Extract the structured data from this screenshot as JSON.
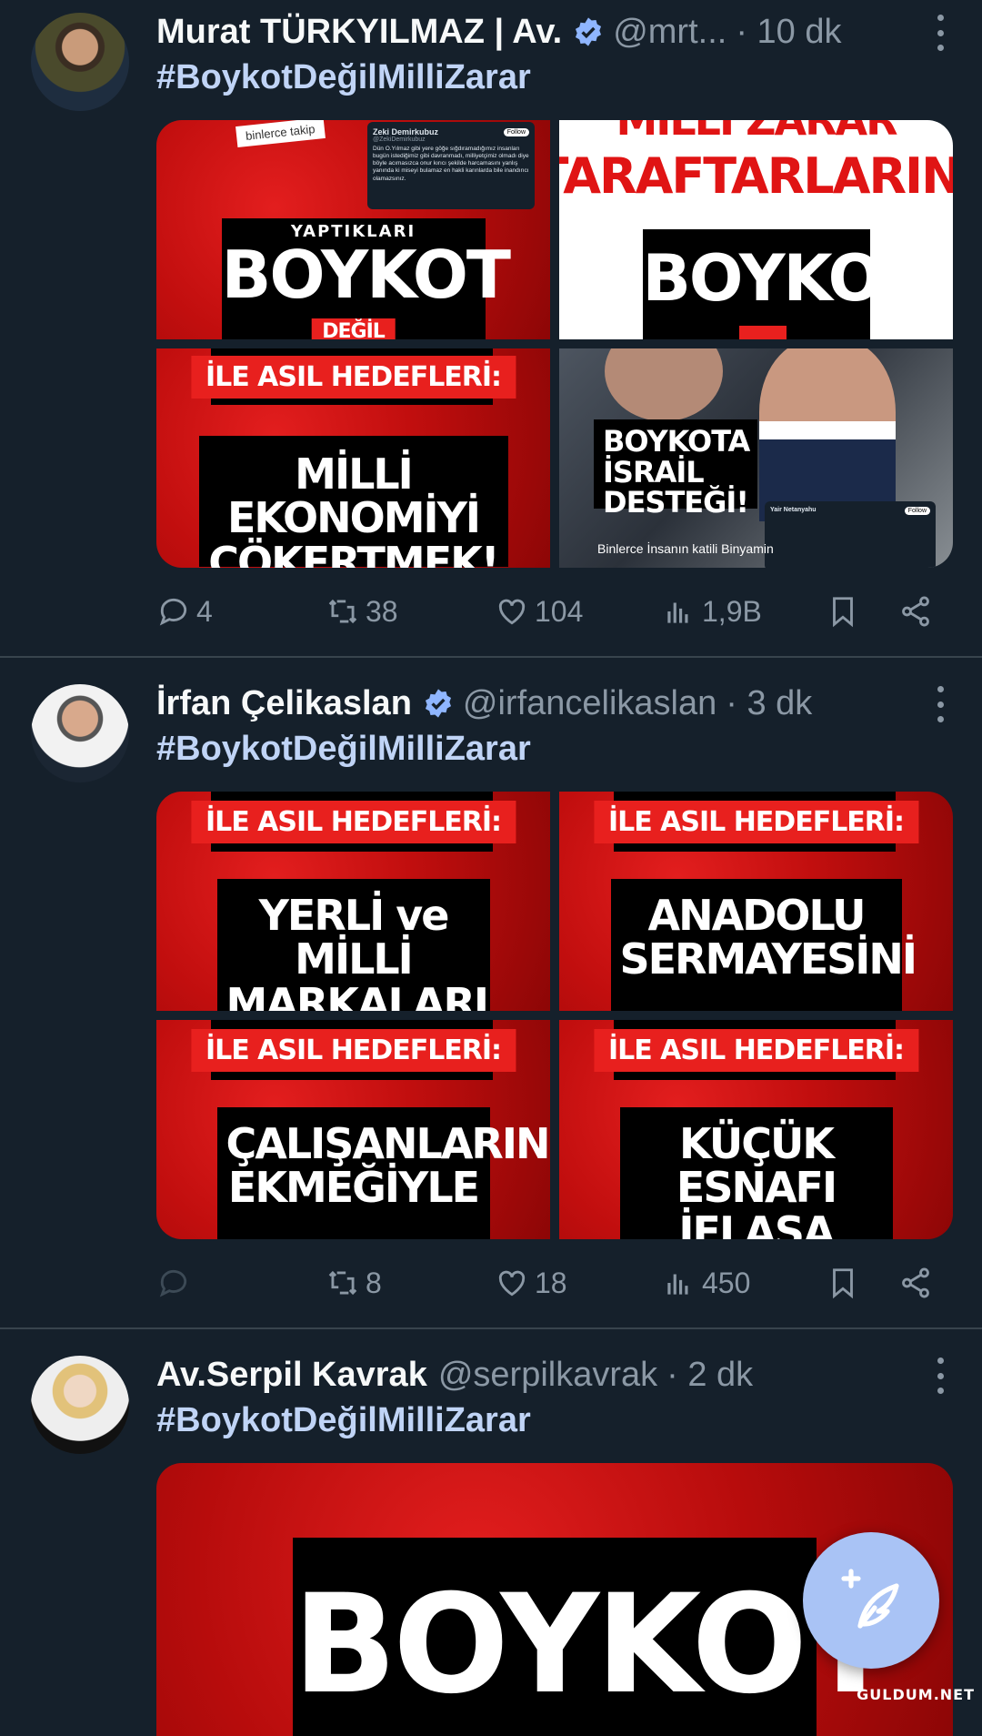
{
  "tweets": [
    {
      "name": "Murat TÜRKYILMAZ | Av.",
      "verified": true,
      "handle": "@mrt...",
      "time": "· 10 dk",
      "hashtag": "#BoykotDeğilMilliZarar",
      "images": {
        "img1": {
          "top_caption": "binlerce takip",
          "card_name": "Zeki Demirkubuz",
          "card_handle": "@ZekiDemirkubuz",
          "card_follow": "Follow",
          "card_text": "Dün O.Yılmaz gibi yere göğe sığdıramadığımız insanları bugün istediğimiz gibi davranmadı, milliyetçimiz olmadı diye böyle acımasızca onur kırıcı şekilde harcamasını yanlış yanında ki miseyi bulamaz en hakli karınlarda bile inandırıcı olamazsınız.",
          "label_small": "YAPTIKLARI",
          "label_big": "BOYKOT",
          "label_cut": "DEĞİL"
        },
        "img2": {
          "red_top": "MİLLİ ZARAR",
          "red_mid": "TARAFTARLARINI",
          "black": "BOYKOT"
        },
        "img3": {
          "band": "İLE ASIL HEDEFLERİ:",
          "black": "MİLLİ EKONOMİYİ ÇÖKERTMEK!"
        },
        "img4": {
          "black": "BOYKOTA İSRAİL DESTEĞİ!",
          "card_name": "Yair Netanyahu",
          "card_follow": "Follow",
          "caption": "Binlerce İnsanın katili Binyamin"
        }
      },
      "stats": {
        "replies": "4",
        "retweets": "38",
        "likes": "104",
        "views": "1,9B"
      }
    },
    {
      "name": "İrfan Çelikaslan",
      "verified": true,
      "handle": "@irfancelikaslan",
      "time": "· 3 dk",
      "hashtag": "#BoykotDeğilMilliZarar",
      "images": {
        "img1": {
          "band": "İLE ASIL HEDEFLERİ:",
          "black": "YERLİ ve MİLLİ MARKALARI"
        },
        "img2": {
          "band": "İLE ASIL HEDEFLERİ:",
          "black": "ANADOLU SERMAYESİNİ"
        },
        "img3": {
          "band": "İLE ASIL HEDEFLERİ:",
          "black": "ÇALIŞANLARIN EKMEĞİYLE"
        },
        "img4": {
          "band": "İLE ASIL HEDEFLERİ:",
          "black": "KÜÇÜK ESNAFI İFLASA"
        }
      },
      "stats": {
        "replies": "",
        "retweets": "8",
        "likes": "18",
        "views": "450"
      }
    },
    {
      "name": "Av.Serpil Kavrak",
      "verified": false,
      "handle": "@serpilkavrak",
      "time": "· 2 dk",
      "hashtag": "#BoykotDeğilMilliZarar",
      "images": {
        "img1": {
          "black": "BOYKOT"
        }
      }
    }
  ],
  "fab": {
    "icon": "compose-feather-plus-icon"
  },
  "watermark": "GULDUM.NET",
  "colors": {
    "background": "#15202b",
    "hashtag": "#c0d4f6",
    "muted": "#8b98a5",
    "fab": "#a9c3f5",
    "verified": "#8fb6ff"
  }
}
